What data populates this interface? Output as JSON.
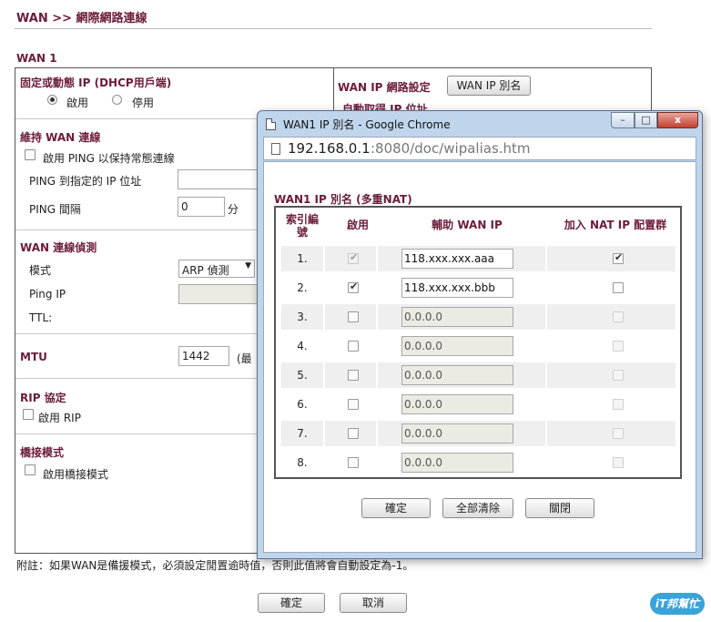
{
  "page": {
    "title": "WAN >> 網際網路連線",
    "wan_label": "WAN 1"
  },
  "left": {
    "ip_mode": {
      "heading": "固定或動態 IP (DHCP用戶端)",
      "enable": "啟用",
      "disable": "停用"
    },
    "keepalive": {
      "heading": "維持 WAN 連線",
      "ping_enable": "啟用 PING 以保持常態連線",
      "ping_ip_label": "PING 到指定的 IP 位址",
      "ping_interval_label": "PING 間隔",
      "ping_interval_value": "0",
      "ping_interval_unit": "分"
    },
    "detect": {
      "heading": "WAN 連線偵測",
      "mode_label": "模式",
      "mode_value": "ARP 偵測",
      "ping_ip_label": "Ping IP",
      "ttl_label": "TTL:"
    },
    "mtu": {
      "heading": "MTU",
      "value": "1442",
      "hint": "(最"
    },
    "rip": {
      "heading": "RIP 協定",
      "enable": "啟用 RIP"
    },
    "bridge": {
      "heading": "橋接模式",
      "enable": "啟用橋接模式"
    }
  },
  "right": {
    "heading": "WAN IP 網路設定",
    "alias_button": "WAN IP 別名",
    "partial_option": "自動取得 IP 位址"
  },
  "note": "附註：如果WAN是備援模式，必須設定閒置逾時值，否則此值將會自動設定為-1。",
  "footer": {
    "ok": "確定",
    "cancel": "取消"
  },
  "popup": {
    "window_title": "WAN1 IP 別名 - Google Chrome",
    "url_host": "192.168.0.1",
    "url_rest": ":8080/doc/wipalias.htm",
    "win_controls": {
      "minimize": "–",
      "maximize": "□",
      "close": "x"
    },
    "table_title": "WAN1 IP 別名 (多重NAT)",
    "headers": {
      "index": "索引編號",
      "enable": "啟用",
      "aux_ip": "輔助 WAN IP",
      "nat": "加入 NAT IP 配置群"
    },
    "rows": [
      {
        "index": "1.",
        "enabled": true,
        "enable_locked": true,
        "ip": "118.xxx.xxx.aaa",
        "editable": true,
        "nat": true,
        "nat_locked": false
      },
      {
        "index": "2.",
        "enabled": true,
        "enable_locked": false,
        "ip": "118.xxx.xxx.bbb",
        "editable": true,
        "nat": false,
        "nat_locked": false
      },
      {
        "index": "3.",
        "enabled": false,
        "enable_locked": false,
        "ip": "0.0.0.0",
        "editable": false,
        "nat": false,
        "nat_locked": true
      },
      {
        "index": "4.",
        "enabled": false,
        "enable_locked": false,
        "ip": "0.0.0.0",
        "editable": false,
        "nat": false,
        "nat_locked": true
      },
      {
        "index": "5.",
        "enabled": false,
        "enable_locked": false,
        "ip": "0.0.0.0",
        "editable": false,
        "nat": false,
        "nat_locked": true
      },
      {
        "index": "6.",
        "enabled": false,
        "enable_locked": false,
        "ip": "0.0.0.0",
        "editable": false,
        "nat": false,
        "nat_locked": true
      },
      {
        "index": "7.",
        "enabled": false,
        "enable_locked": false,
        "ip": "0.0.0.0",
        "editable": false,
        "nat": false,
        "nat_locked": true
      },
      {
        "index": "8.",
        "enabled": false,
        "enable_locked": false,
        "ip": "0.0.0.0",
        "editable": false,
        "nat": false,
        "nat_locked": true
      }
    ],
    "buttons": {
      "ok": "確定",
      "clear_all": "全部清除",
      "close": "關閉"
    }
  },
  "watermark": "iT邦幫忙"
}
